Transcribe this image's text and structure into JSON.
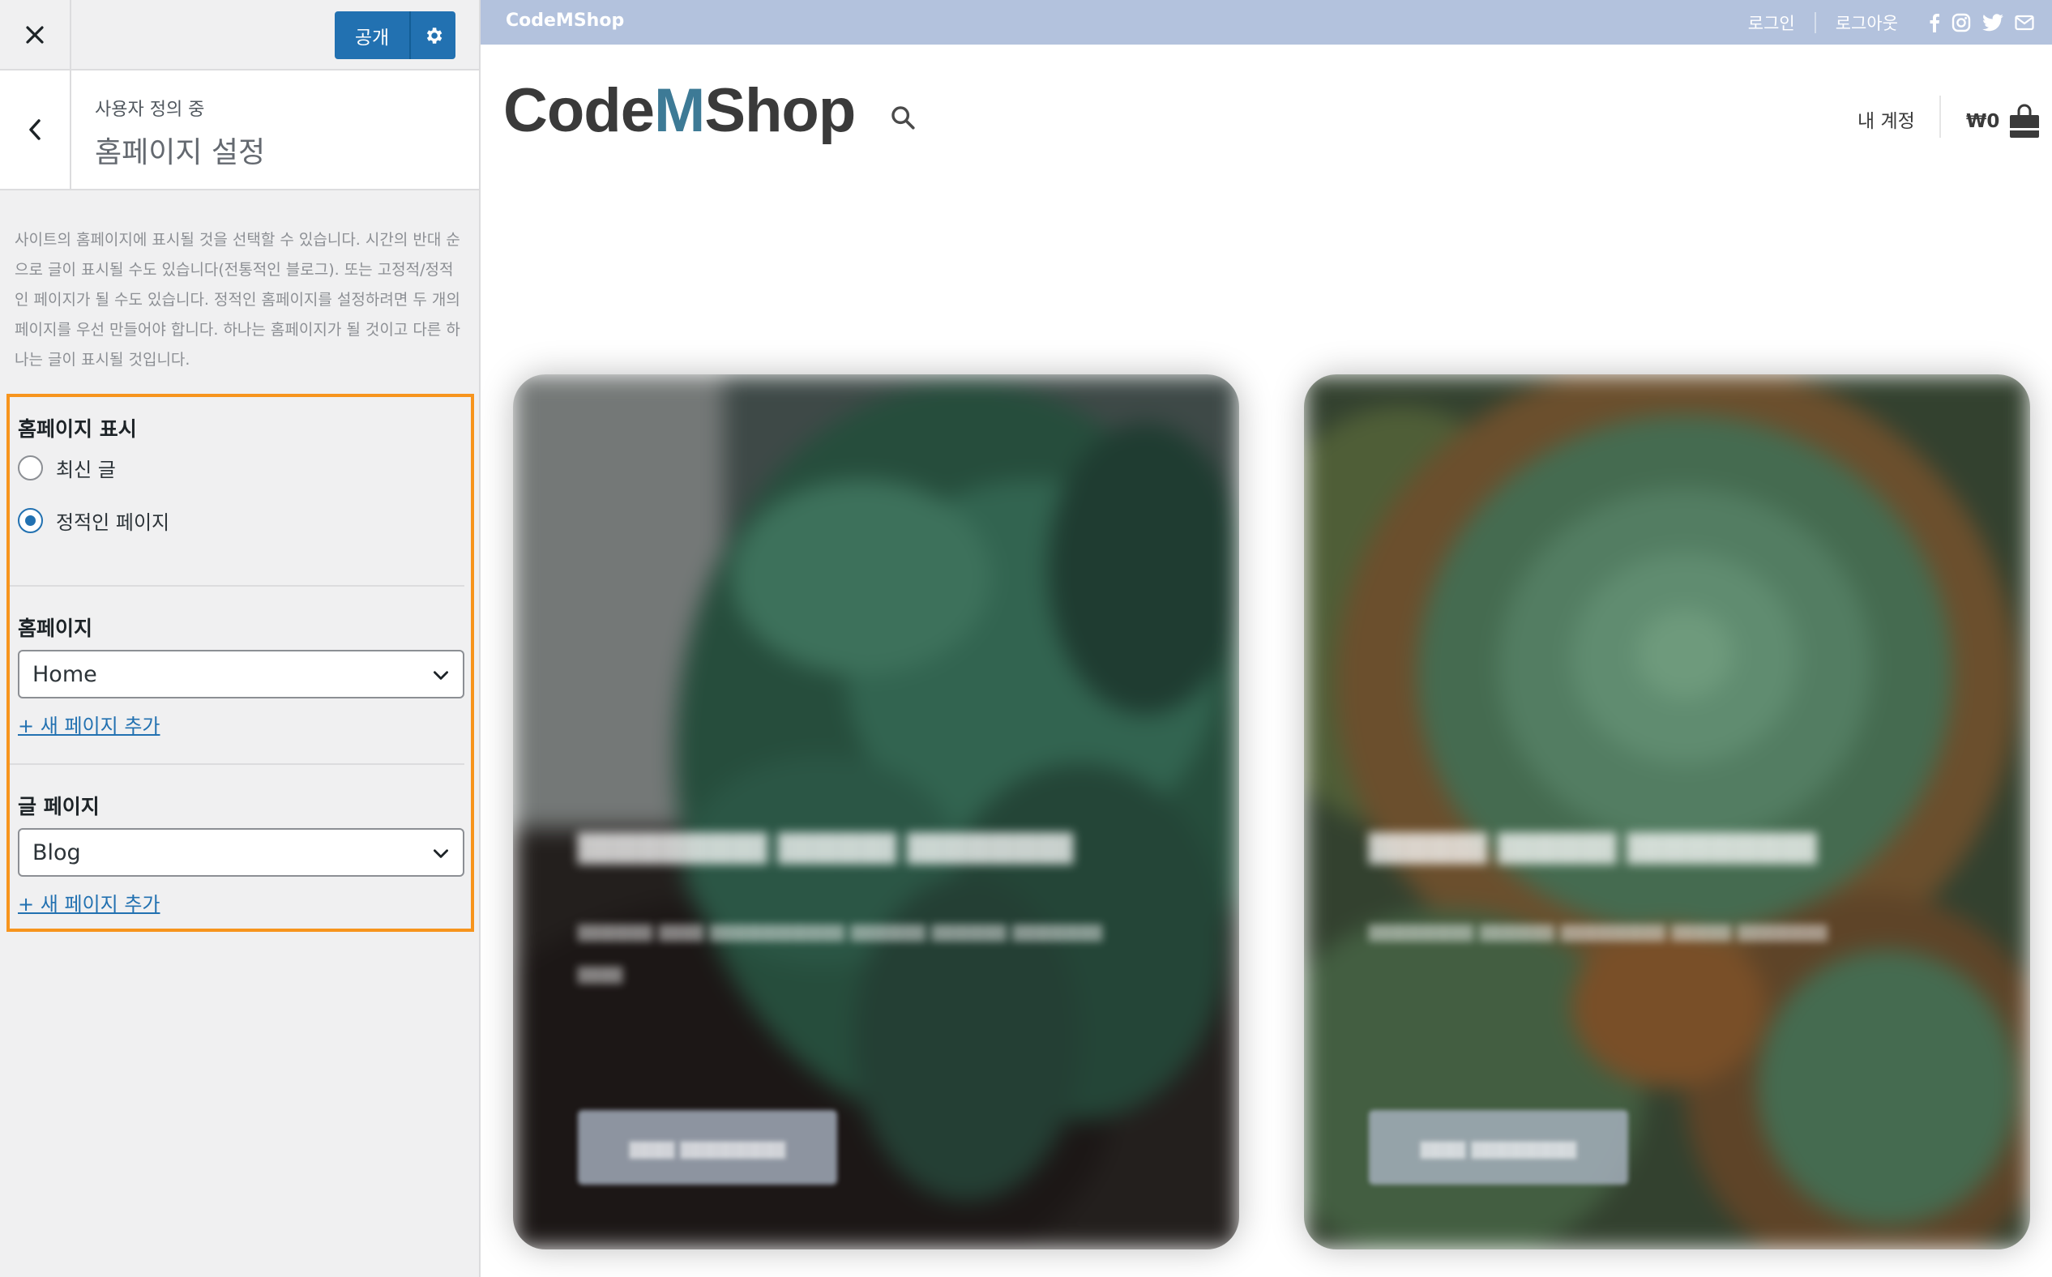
{
  "customizer": {
    "publish_label": "공개",
    "section_subtitle": "사용자 정의 중",
    "section_title": "홈페이지 설정",
    "description": "사이트의 홈페이지에 표시될 것을 선택할 수 있습니다. 시간의 반대 순으로 글이 표시될 수도 있습니다(전통적인 블로그). 또는 고정적/정적인 페이지가 될 수도 있습니다. 정적인 홈페이지를 설정하려면 두 개의 페이지를 우선 만들어야 합니다. 하나는 홈페이지가 될 것이고 다른 하나는 글이 표시될 것입니다.",
    "homepage_display": {
      "heading": "홈페이지 표시",
      "options": [
        {
          "label": "최신 글",
          "checked": false
        },
        {
          "label": "정적인 페이지",
          "checked": true
        }
      ]
    },
    "homepage_select": {
      "heading": "홈페이지",
      "value": "Home",
      "add_link": "+ 새 페이지 추가"
    },
    "posts_select": {
      "heading": "글 페이지",
      "value": "Blog",
      "add_link": "+ 새 페이지 추가"
    },
    "highlight_color": "#f7941d",
    "accent_color": "#2271b1"
  },
  "preview": {
    "topbar": {
      "brand": "CodeMShop",
      "login": "로그인",
      "logout": "로그아웃",
      "social_icons": [
        "facebook-icon",
        "instagram-icon",
        "twitter-icon",
        "mail-icon"
      ],
      "background": "#b3c2dd"
    },
    "header": {
      "logo_part1": "Code",
      "logo_m": "M",
      "logo_part2": "Shop",
      "account": "내 계정",
      "cart_total": "₩0"
    }
  }
}
